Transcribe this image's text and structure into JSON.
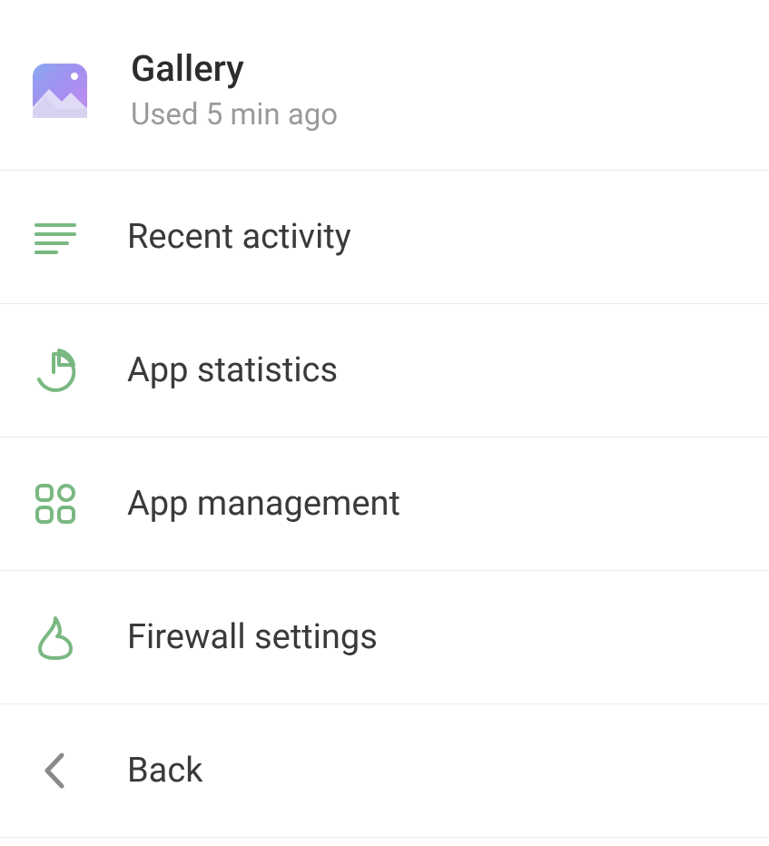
{
  "header": {
    "app_name": "Gallery",
    "subtitle": "Used 5 min ago"
  },
  "menu": [
    {
      "icon": "activity-lines-icon",
      "label": "Recent activity"
    },
    {
      "icon": "pie-chart-icon",
      "label": "App statistics"
    },
    {
      "icon": "grid-apps-icon",
      "label": "App management"
    },
    {
      "icon": "flame-icon",
      "label": "Firewall settings"
    },
    {
      "icon": "chevron-left-icon",
      "label": "Back"
    }
  ],
  "colors": {
    "icon_green": "#7ab882",
    "icon_gray": "#8a8a8a",
    "text_primary": "#3a3a3a",
    "text_secondary": "#9a9a9a"
  }
}
